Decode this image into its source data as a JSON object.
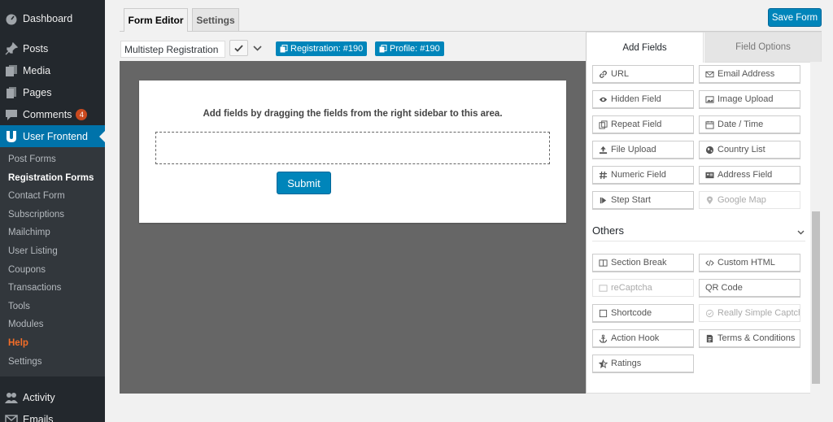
{
  "sidebar": {
    "top_items": [
      {
        "label": "Dashboard",
        "icon": "dashboard-icon"
      },
      {
        "label": "Posts",
        "icon": "pin-icon"
      },
      {
        "label": "Media",
        "icon": "media-icon"
      },
      {
        "label": "Pages",
        "icon": "pages-icon"
      },
      {
        "label": "Comments",
        "icon": "comment-icon",
        "badge": "4"
      },
      {
        "label": "User Frontend",
        "icon": "user-frontend-icon"
      }
    ],
    "submenu": [
      "Post Forms",
      "Registration Forms",
      "Contact Form",
      "Subscriptions",
      "Mailchimp",
      "User Listing",
      "Coupons",
      "Transactions",
      "Tools",
      "Modules",
      "Help",
      "Settings"
    ],
    "bottom_items": [
      {
        "label": "Activity",
        "icon": "activity-icon"
      },
      {
        "label": "Emails",
        "icon": "email-icon"
      }
    ]
  },
  "tabs": {
    "form_editor": "Form Editor",
    "settings": "Settings"
  },
  "toolbar": {
    "form_name": "Multistep Registration Form",
    "save_label": "Save Form",
    "shortcode_registration": "Registration: #190",
    "shortcode_profile": "Profile: #190"
  },
  "canvas": {
    "hint": "Add fields by dragging the fields from the right sidebar to this area.",
    "submit_label": "Submit"
  },
  "panel": {
    "tab_add": "Add Fields",
    "tab_options": "Field Options",
    "fields": [
      {
        "label": "URL",
        "icon": "link-icon"
      },
      {
        "label": "Email Address",
        "icon": "envelope-icon"
      },
      {
        "label": "Hidden Field",
        "icon": "eye-slash-icon"
      },
      {
        "label": "Image Upload",
        "icon": "image-icon"
      },
      {
        "label": "Repeat Field",
        "icon": "copy-icon"
      },
      {
        "label": "Date / Time",
        "icon": "calendar-icon"
      },
      {
        "label": "File Upload",
        "icon": "upload-icon"
      },
      {
        "label": "Country List",
        "icon": "globe-icon"
      },
      {
        "label": "Numeric Field",
        "icon": "hash-icon"
      },
      {
        "label": "Address Field",
        "icon": "address-card-icon"
      },
      {
        "label": "Step Start",
        "icon": "step-forward-icon"
      },
      {
        "label": "Google Map",
        "icon": "map-marker-icon",
        "disabled": true
      }
    ],
    "others_title": "Others",
    "others": [
      {
        "label": "Section Break",
        "icon": "columns-icon"
      },
      {
        "label": "Custom HTML",
        "icon": "code-icon"
      },
      {
        "label": "reCaptcha",
        "icon": "recaptcha-icon",
        "disabled": true
      },
      {
        "label": "QR Code",
        "icon": "",
        "disabled": false
      },
      {
        "label": "Shortcode",
        "icon": "square-icon"
      },
      {
        "label": "Really Simple Captcha",
        "icon": "check-circle-icon",
        "disabled": true
      },
      {
        "label": "Action Hook",
        "icon": "anchor-icon"
      },
      {
        "label": "Terms & Conditions",
        "icon": "file-text-icon"
      },
      {
        "label": "Ratings",
        "icon": "star-half-icon"
      }
    ]
  },
  "colors": {
    "accent": "#0085ba",
    "sidebar_bg": "#23282d",
    "sidebar_current": "#0073aa",
    "help": "#f56e28",
    "canvas_bg": "#666666"
  }
}
